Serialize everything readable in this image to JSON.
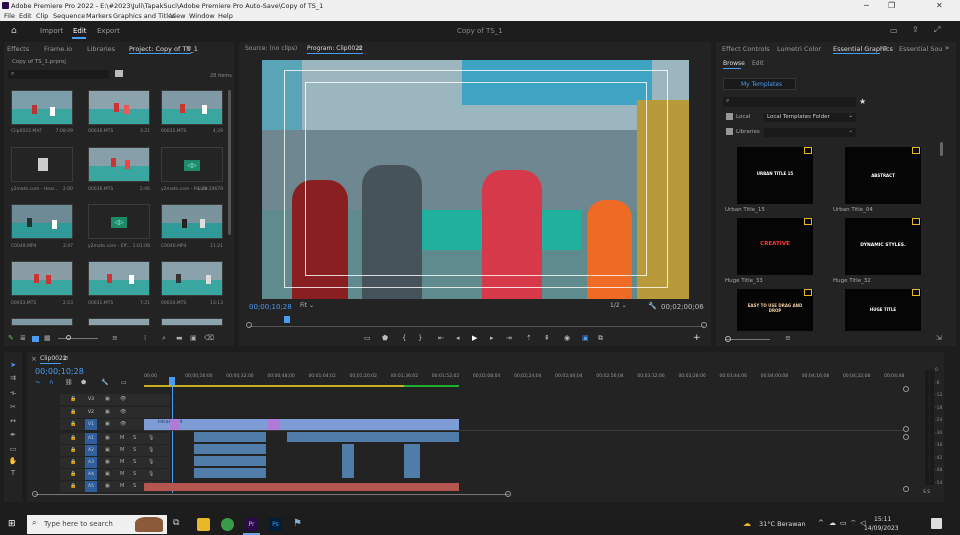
{
  "window": {
    "title": "Adobe Premiere Pro 2022 - E:\\#2023\\Juli\\TapakSuci\\Adobe Premiere Pro Auto-Save\\Copy of TS_1",
    "project_name": "Copy of TS_1"
  },
  "menu": [
    "File",
    "Edit",
    "Clip",
    "Sequence",
    "Markers",
    "Graphics and Titles",
    "View",
    "Window",
    "Help"
  ],
  "workspaces": [
    "Import",
    "Edit",
    "Export"
  ],
  "project_panel": {
    "tabs": [
      "Effects",
      "Frame.io",
      "Libraries",
      "Project: Copy of TS_1"
    ],
    "bin_path": "Copy of TS_1.prproj",
    "item_count": "28 items",
    "items": [
      {
        "name": "Clip0022.MXF",
        "duration": "7:08:09"
      },
      {
        "name": "00036.MTS",
        "duration": "3:21"
      },
      {
        "name": "00035.MTS",
        "duration": "4:29"
      },
      {
        "name": "y2mate.com - Hear...",
        "duration": "2:00"
      },
      {
        "name": "00036.MTS",
        "duration": "2:06"
      },
      {
        "name": "y2mate.com - Punch...",
        "duration": "1:28:19679"
      },
      {
        "name": "C0048.MP4",
        "duration": "3:47"
      },
      {
        "name": "y2mate.com - Eff...",
        "duration": "1:01:08"
      },
      {
        "name": "C0046.MP4",
        "duration": "11:21"
      },
      {
        "name": "00033.MTS",
        "duration": "2:23"
      },
      {
        "name": "00031.MTS",
        "duration": "7:21"
      },
      {
        "name": "00034.MTS",
        "duration": "13:13"
      }
    ]
  },
  "source_tab": "Source: (no clips)",
  "program_tab": "Program: Clip0022",
  "program_monitor": {
    "timecode": "00;00;10;28",
    "fit": "Fit",
    "resolution": "1/2",
    "duration": "00;02;00;06"
  },
  "essential_graphics": {
    "tabs": [
      "Effect Controls",
      "Lumetri Color",
      "Essential Graphics",
      "Essential Sou"
    ],
    "subtabs": [
      "Browse",
      "Edit"
    ],
    "my_templates": "My Templates",
    "local_label": "Local",
    "local_folder": "Local Templates Folder",
    "libraries_label": "Libraries",
    "templates": [
      {
        "name": "Urban Title_15",
        "text": "URBAN TITLE 15"
      },
      {
        "name": "Urban Title_04",
        "text": "ABSTRACT"
      },
      {
        "name": "Huge Title_33",
        "text": "CREATIVE"
      },
      {
        "name": "Huge Title_32",
        "text": "DYNAMIC STYLES."
      },
      {
        "name": "",
        "text": "EASY TO USE DRAG AND DROP"
      },
      {
        "name": "",
        "text": "HUGE TITLE"
      }
    ]
  },
  "timeline": {
    "sequence_tab": "Clip0022",
    "timecode": "00;00;10;28",
    "ruler": [
      "00;00",
      "00;00;16;00",
      "00;00;32;00",
      "00;00;48;00",
      "00;01;04;02",
      "00;01;20;02",
      "00;01;36;02",
      "00;01;52;02",
      "00;02;08;04",
      "00;02;24;04",
      "00;02;40;04",
      "00;02;56;04",
      "00;03;12;06",
      "00;03;28;06",
      "00;03;44;06",
      "00;04;00;08",
      "00;04;16;08",
      "00;04;32;08",
      "00;04;48"
    ],
    "video_tracks": [
      "V3",
      "V2",
      "V1"
    ],
    "audio_tracks": [
      "A1",
      "A2",
      "A3",
      "A4",
      "A5"
    ],
    "clip_label": "Intras.mp4",
    "meter_ticks": [
      "0",
      "-6",
      "-12",
      "-18",
      "-24",
      "-30",
      "-36",
      "-42",
      "-48",
      "-54"
    ],
    "meter_footer": "S S"
  },
  "taskbar": {
    "search_placeholder": "Type here to search",
    "weather": "31°C Berawan",
    "time": "15:11",
    "date": "14/09/2023"
  }
}
